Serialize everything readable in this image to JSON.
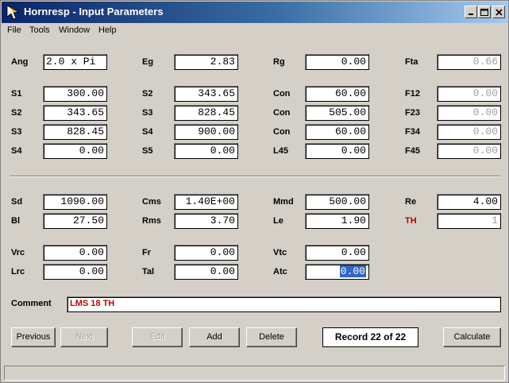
{
  "window": {
    "title": "Hornresp - Input Parameters"
  },
  "menu": [
    "File",
    "Tools",
    "Window",
    "Help"
  ],
  "labels": {
    "ang": "Ang",
    "eg": "Eg",
    "rg": "Rg",
    "fta": "Fta",
    "s1": "S1",
    "s2": "S2",
    "s3": "S3",
    "s4": "S4",
    "s5": "S5",
    "con": "Con",
    "l45": "L45",
    "f12": "F12",
    "f23": "F23",
    "f34": "F34",
    "f45": "F45",
    "sd": "Sd",
    "bl": "Bl",
    "cms": "Cms",
    "rms": "Rms",
    "mmd": "Mmd",
    "le": "Le",
    "re": "Re",
    "th": "TH",
    "vrc": "Vrc",
    "lrc": "Lrc",
    "fr": "Fr",
    "tal": "Tal",
    "vtc": "Vtc",
    "atc": "Atc",
    "comment": "Comment"
  },
  "values": {
    "ang": "2.0 x Pi",
    "eg": "2.83",
    "rg": "0.00",
    "fta": "0.66",
    "s1_1": "300.00",
    "s2_1": "343.65",
    "con_1": "60.00",
    "f12": "0.00",
    "s2_2": "343.65",
    "s3_2": "828.45",
    "con_2": "505.00",
    "f23": "0.00",
    "s3_3": "828.45",
    "s4_3": "900.00",
    "con_3": "60.00",
    "f34": "0.00",
    "s4_4": "0.00",
    "s5_4": "0.00",
    "l45": "0.00",
    "f45": "0.00",
    "sd": "1090.00",
    "cms": "1.40E+00",
    "mmd": "500.00",
    "re": "4.00",
    "bl": "27.50",
    "rms": "3.70",
    "le": "1.90",
    "th": "1",
    "vrc": "0.00",
    "fr": "0.00",
    "vtc": "0.00",
    "lrc": "0.00",
    "tal": "0.00",
    "atc": "0.00",
    "comment": "LMS 18 TH"
  },
  "buttons": {
    "previous": "Previous",
    "next": "Next",
    "edit": "Edit",
    "add": "Add",
    "delete": "Delete",
    "calculate": "Calculate"
  },
  "record": "Record 22 of 22",
  "colors": {
    "title_start": "#0a246a",
    "title_end": "#a6caf0",
    "accent_red": "#c00000",
    "selection": "#3167c5"
  }
}
